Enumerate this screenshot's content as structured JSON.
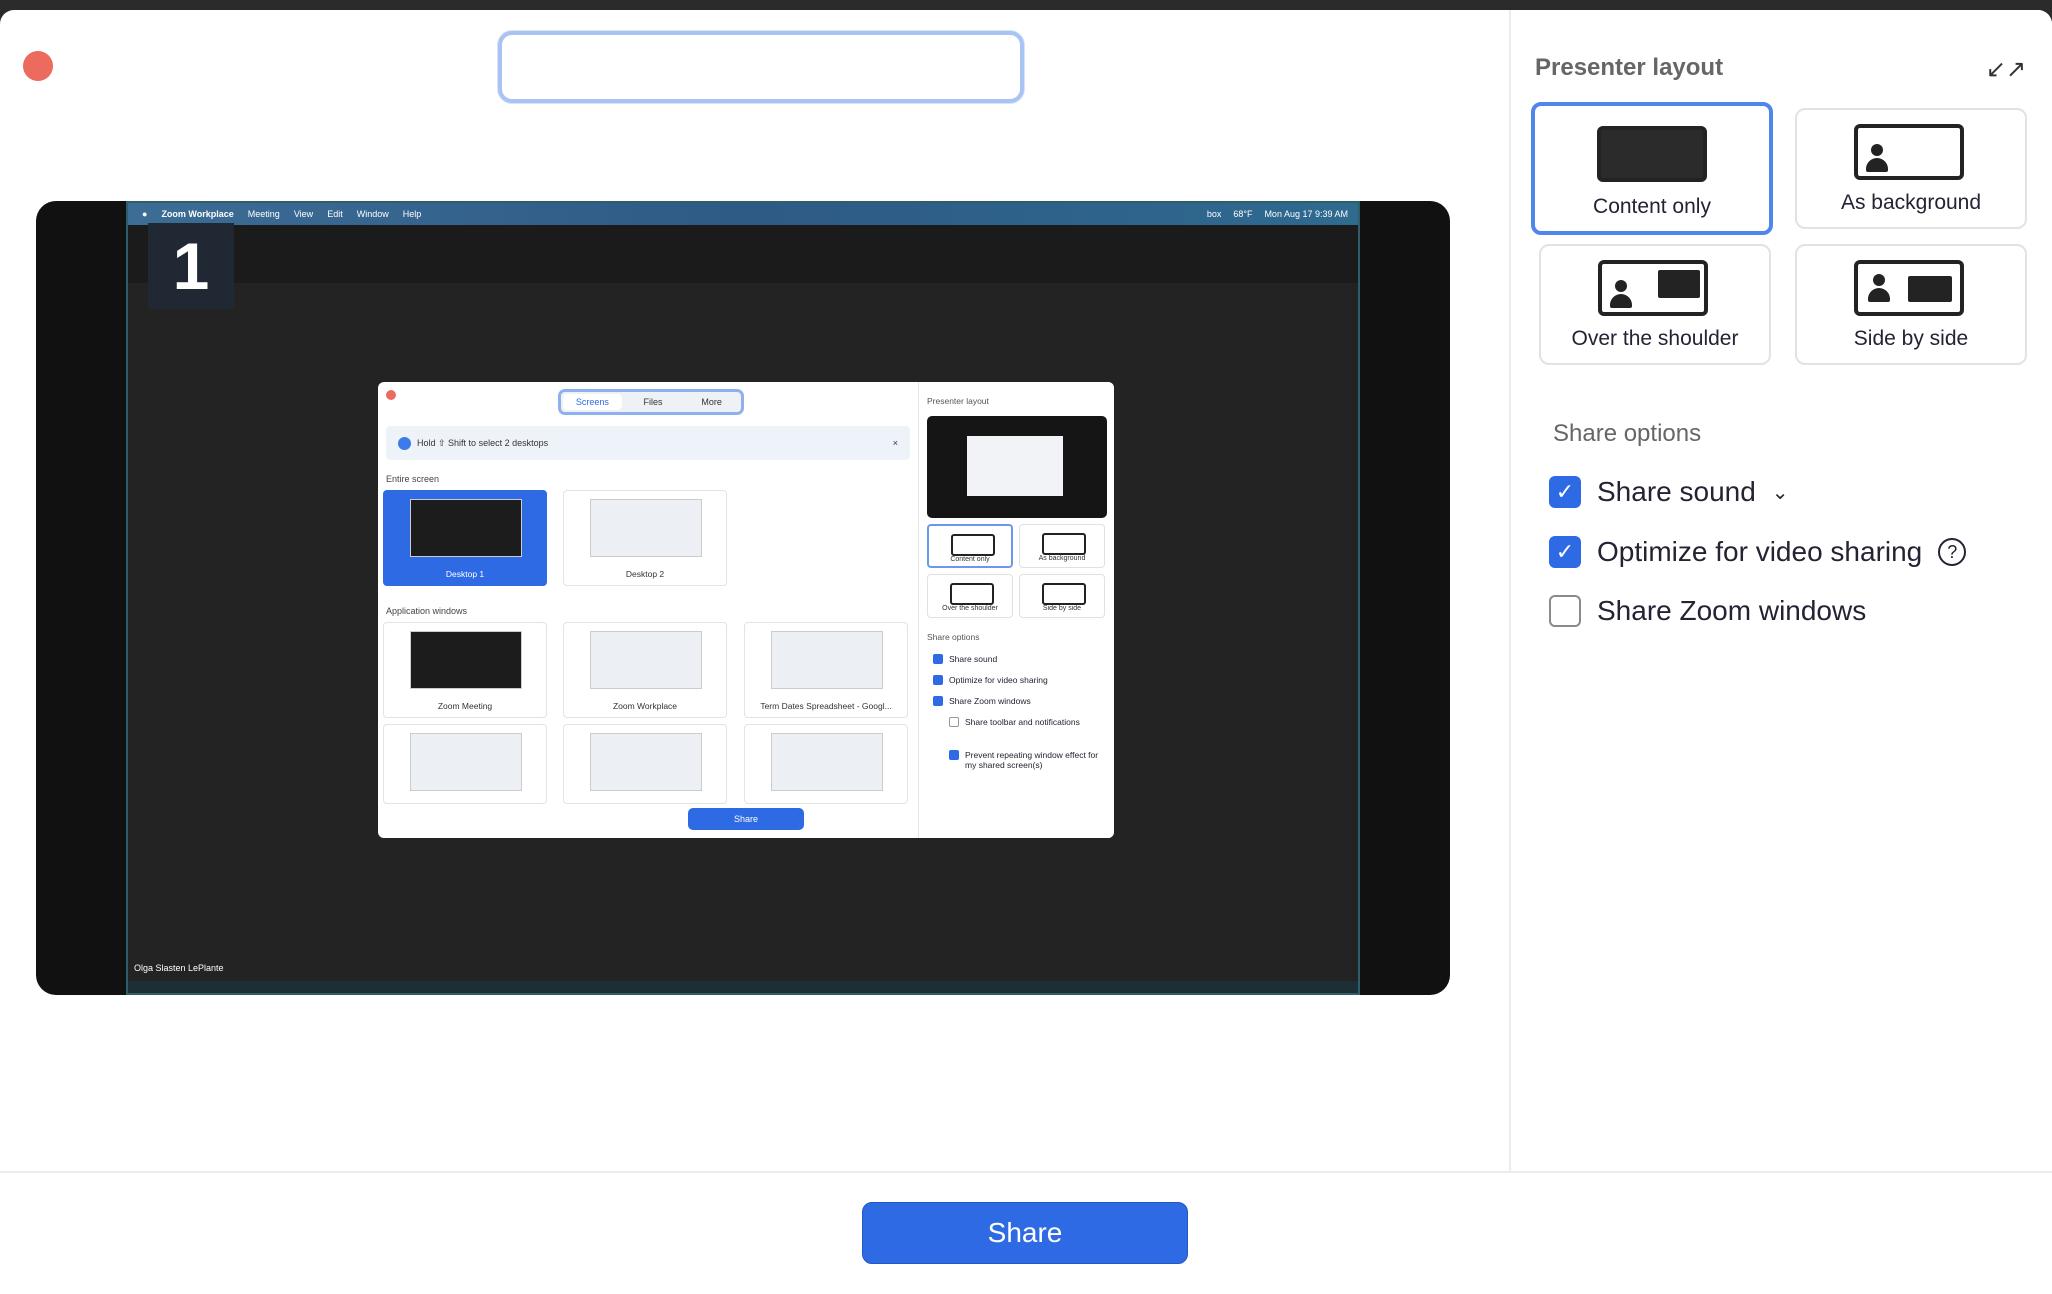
{
  "window": {
    "close_icon": "close-dot"
  },
  "preview": {
    "screen_number": "1",
    "menubar": {
      "app": "Zoom Workplace",
      "items": [
        "Meeting",
        "View",
        "Edit",
        "Window",
        "Help"
      ],
      "right": [
        "box",
        "68°F",
        "Mon Aug 17  9:39 AM"
      ]
    },
    "participant_name": "Olga Slasten LePlante",
    "mini_dialog": {
      "tabs": [
        "Screens",
        "Files",
        "More"
      ],
      "info": "Hold ⇧ Shift to select 2 desktops",
      "entire_screen_label": "Entire screen",
      "desktops": [
        "Desktop 1",
        "Desktop 2"
      ],
      "application_windows_label": "Application windows",
      "apps": [
        "Zoom Meeting",
        "Zoom Workplace",
        "Term Dates Spreadsheet - Googl..."
      ],
      "share_label": "Share",
      "presenter_layout": "Presenter layout",
      "layouts": [
        "Content only",
        "As background",
        "Over the shoulder",
        "Side by side"
      ],
      "share_options": "Share options",
      "options": [
        "Share sound",
        "Optimize for video sharing",
        "Share Zoom windows",
        "Share toolbar and notifications",
        "Prevent repeating window effect for my shared screen(s)"
      ]
    }
  },
  "side": {
    "title": "Presenter layout",
    "collapse_icon": "↙↗",
    "layouts": [
      {
        "label": "Content only",
        "selected": true
      },
      {
        "label": "As background",
        "selected": false
      },
      {
        "label": "Over the shoulder",
        "selected": false
      },
      {
        "label": "Side by side",
        "selected": false
      }
    ],
    "share_options_title": "Share options",
    "options": [
      {
        "label": "Share sound",
        "checked": true,
        "chevron": "⌄"
      },
      {
        "label": "Optimize for video sharing",
        "checked": true,
        "help": "?"
      },
      {
        "label": "Share Zoom windows",
        "checked": false
      }
    ]
  },
  "footer": {
    "share_label": "Share"
  },
  "colors": {
    "accent": "#2d6ae3",
    "selected_border": "#4f86ec"
  }
}
